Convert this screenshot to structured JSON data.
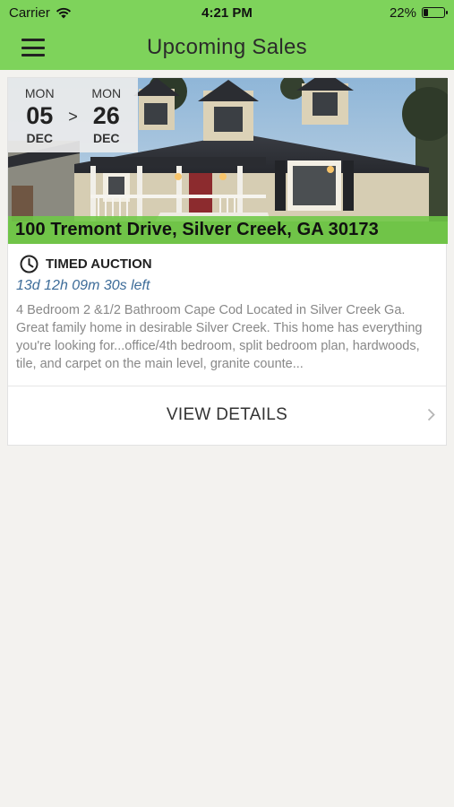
{
  "status": {
    "carrier": "Carrier",
    "time": "4:21 PM",
    "battery": "22%",
    "battery_level": 0.22
  },
  "nav": {
    "title": "Upcoming Sales",
    "menu_icon": "hamburger-menu-icon"
  },
  "sale": {
    "start": {
      "dow": "MON",
      "day": "05",
      "month": "DEC"
    },
    "arrow": ">",
    "end": {
      "dow": "MON",
      "day": "26",
      "month": "DEC"
    },
    "address": "100 Tremont Drive, Silver Creek, GA 30173",
    "auction_type": "TIMED AUCTION",
    "time_left": "13d 12h 09m 30s left",
    "description": "4 Bedroom 2 &1/2 Bathroom Cape Cod Located in Silver Creek Ga. Great family home in desirable Silver Creek. This home has everything you're looking for...office/4th bedroom, split bedroom plan, hardwoods, tile, and carpet on the main level, granite counte...",
    "details_label": "VIEW DETAILS"
  },
  "colors": {
    "brand_green": "#7ed35b",
    "time_left_blue": "#3d6c99"
  }
}
